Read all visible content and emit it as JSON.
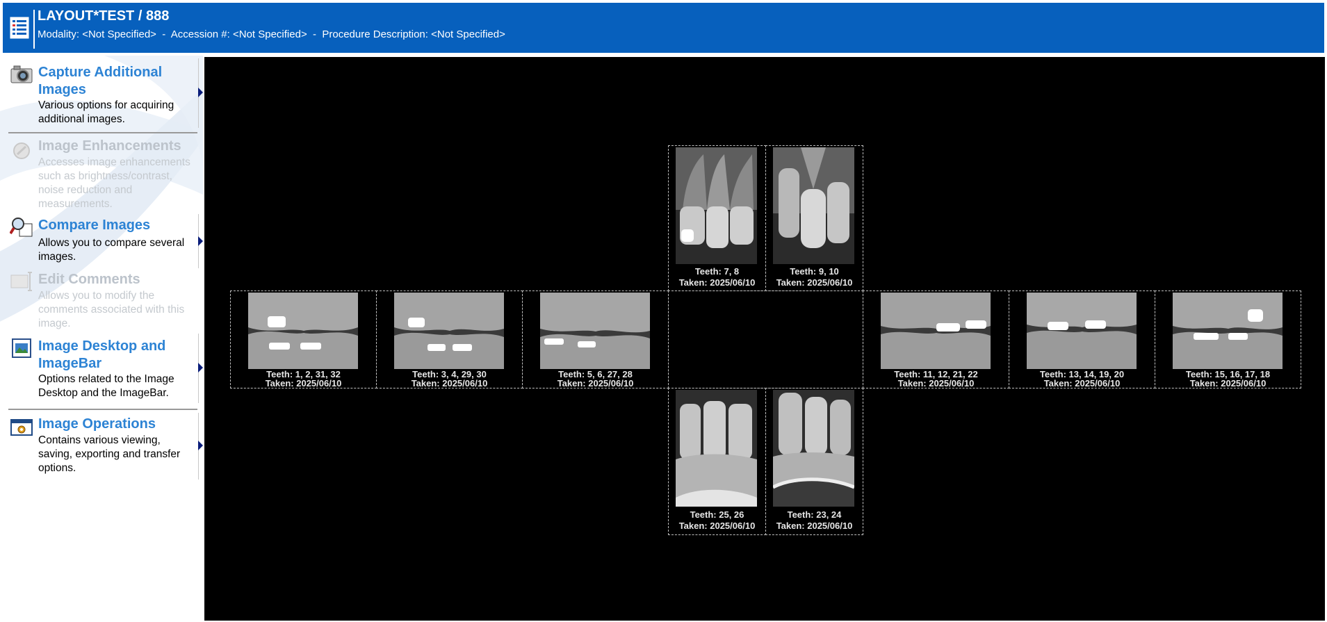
{
  "header": {
    "title": "LAYOUT*TEST / 888",
    "subtitle": "Modality: <Not Specified>  -  Accession #: <Not Specified>  -  Procedure Description: <Not Specified>",
    "background_color": "#0760bd",
    "icon": "list-icon"
  },
  "sidebar": {
    "items": [
      {
        "title": "Capture Additional Images",
        "description": "Various options for acquiring additional images.",
        "icon": "camera-icon",
        "enabled": true
      },
      {
        "title": "Image Enhancements",
        "description": "Accesses image enhancements such as brightness/contrast, noise reduction and measurements.",
        "icon": "enhance-icon",
        "enabled": false
      },
      {
        "title": "Compare Images",
        "description": "Allows you to compare several images.",
        "icon": "magnifier-icon",
        "enabled": true
      },
      {
        "title": "Edit Comments",
        "description": "Allows you to modify the comments associated with this image.",
        "icon": "comment-icon",
        "enabled": false
      },
      {
        "title": "Image Desktop and ImageBar",
        "description": "Options related to the Image Desktop and the ImageBar.",
        "icon": "desktop-icon",
        "enabled": true
      },
      {
        "title": "Image Operations",
        "description": "Contains various viewing, saving, exporting and transfer options.",
        "icon": "operations-icon",
        "enabled": true
      }
    ],
    "title_color": "#2d83d4",
    "disabled_color": "#bcc3cb"
  },
  "viewer": {
    "background_color": "#000000",
    "tiles": [
      {
        "teeth": "Teeth: 7, 8",
        "taken": "Taken: 2025/06/10",
        "kind": "upper-anterior"
      },
      {
        "teeth": "Teeth: 9, 10",
        "taken": "Taken: 2025/06/10",
        "kind": "upper-anterior"
      },
      {
        "teeth": "Teeth: 1, 2, 31, 32",
        "taken": "Taken: 2025/06/10",
        "kind": "bitewing"
      },
      {
        "teeth": "Teeth: 3, 4, 29, 30",
        "taken": "Taken: 2025/06/10",
        "kind": "bitewing"
      },
      {
        "teeth": "Teeth: 5, 6, 27, 28",
        "taken": "Taken: 2025/06/10",
        "kind": "bitewing"
      },
      {
        "teeth": "Teeth: 11, 12, 21, 22",
        "taken": "Taken: 2025/06/10",
        "kind": "bitewing"
      },
      {
        "teeth": "Teeth: 13, 14, 19, 20",
        "taken": "Taken: 2025/06/10",
        "kind": "bitewing"
      },
      {
        "teeth": "Teeth: 15, 16, 17, 18",
        "taken": "Taken: 2025/06/10",
        "kind": "bitewing"
      },
      {
        "teeth": "Teeth: 25, 26",
        "taken": "Taken: 2025/06/10",
        "kind": "lower-anterior"
      },
      {
        "teeth": "Teeth: 23, 24",
        "taken": "Taken: 2025/06/10",
        "kind": "lower-anterior"
      }
    ]
  }
}
